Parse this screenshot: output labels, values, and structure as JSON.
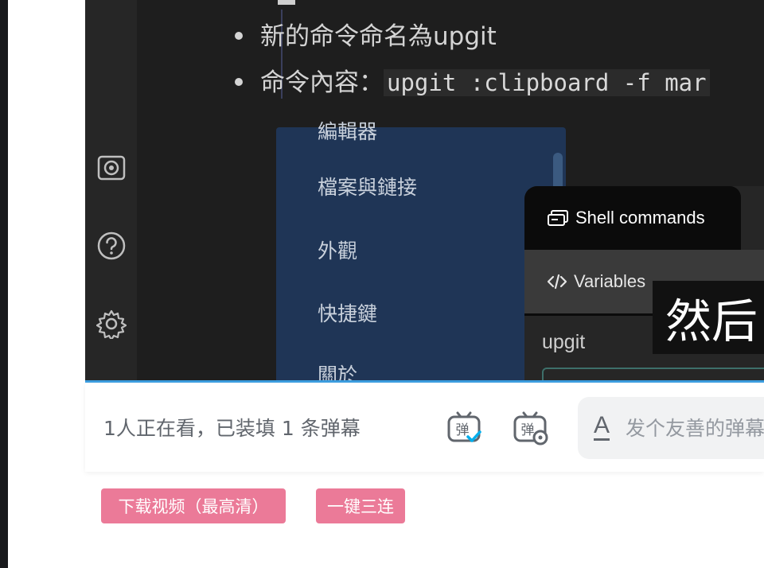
{
  "video": {
    "doc_lines": [
      {
        "text": "新的命令命名為upgit"
      },
      {
        "text": "命令內容：",
        "code": "upgit :clipboard -f mar"
      }
    ],
    "settings_menu": {
      "cut_item": "編輯器",
      "items": [
        "檔案與鏈接",
        "外觀",
        "快捷鍵",
        "關於"
      ]
    },
    "plugin": {
      "tabs": [
        "Shell commands",
        "Variables"
      ],
      "command_name": "upgit"
    },
    "subtitle": "然后"
  },
  "control_bar": {
    "viewers_text": "1人正在看，已装填 1 条弹幕",
    "danmaku_placeholder": "发个友善的弹幕见证当下",
    "accent_color": "#00aeec"
  },
  "actions": {
    "download_label": "下载视频（最高清）",
    "triple_label": "一键三连",
    "button_color": "#eb7a98"
  }
}
